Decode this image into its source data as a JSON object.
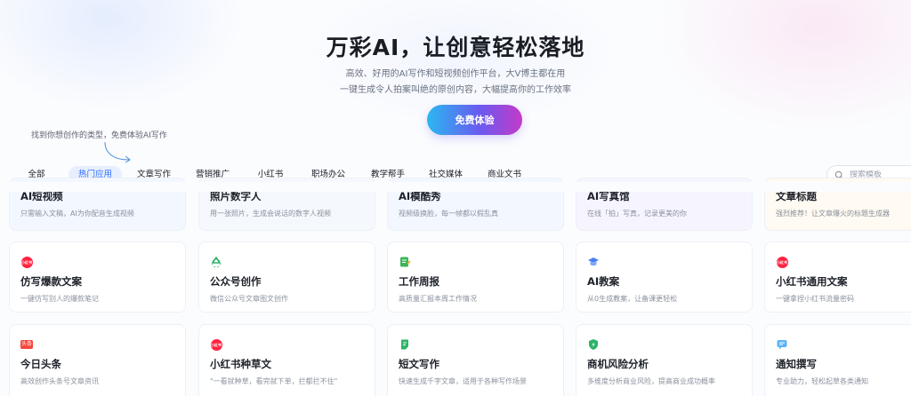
{
  "hero": {
    "title": "万彩AI，让创意轻松落地",
    "subtitle_line1": "高效、好用的AI写作和短视频创作平台，大V博主都在用",
    "subtitle_line2": "一键生成令人拍案叫绝的原创内容，大幅提高你的工作效率",
    "cta_label": "免费体验",
    "hint": "找到你想创作的类型，免费体验AI写作"
  },
  "tabs": [
    {
      "label": "全部"
    },
    {
      "label": "热门应用",
      "active": true
    },
    {
      "label": "文章写作"
    },
    {
      "label": "营销推广"
    },
    {
      "label": "小红书"
    },
    {
      "label": "职场办公"
    },
    {
      "label": "教学帮手"
    },
    {
      "label": "社交媒体"
    },
    {
      "label": "商业文书"
    }
  ],
  "search": {
    "placeholder": "搜索模板"
  },
  "cards": {
    "row0": [
      {
        "title": "AI短视频",
        "desc": "只需输入文稿，AI为你配音生成视频"
      },
      {
        "title": "照片数字人",
        "desc": "用一张照片，生成会说话的数字人视频"
      },
      {
        "title": "AI模酷秀",
        "desc": "视频级换脸，每一帧都以假乱真"
      },
      {
        "title": "AI写真馆",
        "desc": "在线「拍」写真，记录更美的你"
      },
      {
        "title": "文章标题",
        "desc": "强烈推荐！让文章爆火的标题生成器"
      }
    ],
    "row1": [
      {
        "icon": "xiaohongshu-icon",
        "badge": "小红书",
        "title": "仿写爆款文案",
        "desc": "一键仿写别人的爆款笔记"
      },
      {
        "icon": "recycle-icon",
        "title": "公众号创作",
        "desc": "微信公众号文章图文创作"
      },
      {
        "icon": "notepad-icon",
        "title": "工作周报",
        "desc": "高质量汇报本周工作情况"
      },
      {
        "icon": "graduation-cap-icon",
        "title": "AI教案",
        "desc": "从0生成教案，让备课更轻松"
      },
      {
        "icon": "xiaohongshu-icon",
        "badge": "小红书",
        "title": "小红书通用文案",
        "desc": "一键拿捏小红书流量密码"
      }
    ],
    "row2": [
      {
        "icon": "toutiao-icon",
        "badge": "头条",
        "title": "今日头条",
        "desc": "高效创作头条号文章资讯"
      },
      {
        "icon": "xiaohongshu-icon",
        "badge": "小红书",
        "title": "小红书种草文",
        "desc": "\"一看就种草，看完就下单，拦都拦不住\""
      },
      {
        "icon": "document-icon",
        "title": "短文写作",
        "desc": "快速生成千字文章，适用于各种写作场景"
      },
      {
        "icon": "shield-icon",
        "title": "商机风险分析",
        "desc": "多维度分析商业风险，提高商业成功概率"
      },
      {
        "icon": "chat-icon",
        "title": "通知撰写",
        "desc": "专业助力，轻松起草各类通知"
      }
    ]
  }
}
